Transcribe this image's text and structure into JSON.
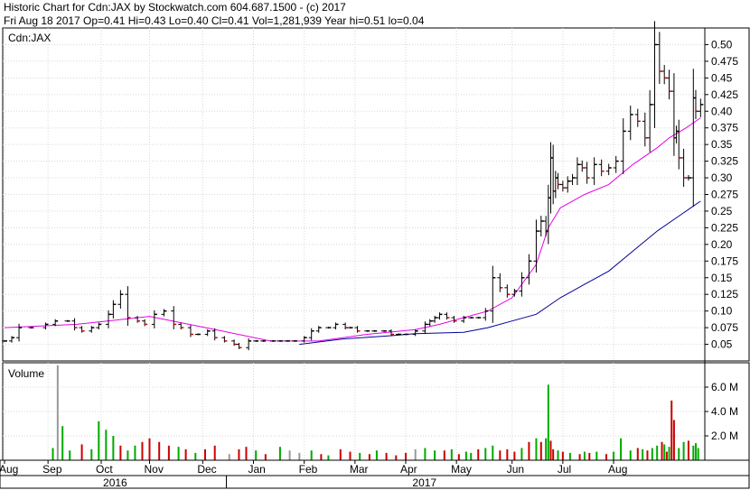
{
  "header": {
    "title": "Historic Chart for Cdn:JAX by Stockwatch.com 604.687.1500 - (c) 2017",
    "summary": "Fri Aug 18 2017  Op=0.41  Hi=0.43  Lo=0.40  Cl=0.41  Vol=1,281,939  Year hi=0.51  lo=0.04"
  },
  "chart_data": [
    {
      "type": "ohlc",
      "title": "Cdn:JAX",
      "ylim": [
        0.025,
        0.525
      ],
      "yticks": [
        "0.05",
        "0.075",
        "0.10",
        "0.125",
        "0.15",
        "0.175",
        "0.20",
        "0.225",
        "0.25",
        "0.275",
        "0.30",
        "0.325",
        "0.35",
        "0.375",
        "0.40",
        "0.425",
        "0.45",
        "0.475",
        "0.50"
      ],
      "grid": true,
      "colors": {
        "bar": "#000000",
        "up": "#000000",
        "down": "#cc0000",
        "ma_short": "#e600e6",
        "ma_long": "#000099"
      },
      "series": [
        {
          "name": "price_close",
          "x": [
            0,
            3,
            6,
            11,
            17,
            21,
            26,
            29,
            32,
            36,
            39,
            43,
            45,
            48,
            51,
            55,
            58,
            62,
            66,
            70,
            73,
            77,
            80,
            84,
            87,
            91,
            95,
            97,
            101,
            104,
            107,
            111,
            114,
            117,
            120,
            124,
            127,
            130,
            134,
            137,
            141,
            143,
            146,
            150,
            153,
            157,
            160,
            163,
            166,
            170,
            174,
            176,
            178,
            180,
            183,
            186,
            190,
            193,
            196,
            199,
            202,
            205,
            208,
            211,
            214,
            217,
            220,
            222,
            224,
            225,
            226,
            227,
            228,
            229,
            231,
            233,
            235,
            237,
            239,
            241,
            244,
            247,
            250,
            253,
            256,
            259,
            262,
            265,
            267,
            269,
            271,
            273,
            275,
            277,
            278,
            279,
            281,
            283,
            285,
            286,
            288
          ],
          "values": [
            0.055,
            0.06,
            0.075,
            0.075,
            0.08,
            0.085,
            0.085,
            0.075,
            0.07,
            0.075,
            0.08,
            0.095,
            0.11,
            0.125,
            0.09,
            0.085,
            0.08,
            0.095,
            0.1,
            0.08,
            0.075,
            0.065,
            0.065,
            0.07,
            0.06,
            0.055,
            0.05,
            0.045,
            0.055,
            0.055,
            0.055,
            0.055,
            0.055,
            0.055,
            0.055,
            0.06,
            0.07,
            0.075,
            0.075,
            0.08,
            0.075,
            0.075,
            0.07,
            0.07,
            0.07,
            0.07,
            0.065,
            0.065,
            0.065,
            0.07,
            0.08,
            0.085,
            0.09,
            0.095,
            0.09,
            0.085,
            0.09,
            0.09,
            0.09,
            0.1,
            0.15,
            0.135,
            0.125,
            0.13,
            0.15,
            0.175,
            0.22,
            0.235,
            0.22,
            0.27,
            0.33,
            0.28,
            0.3,
            0.29,
            0.285,
            0.295,
            0.3,
            0.32,
            0.315,
            0.3,
            0.32,
            0.31,
            0.315,
            0.325,
            0.37,
            0.395,
            0.385,
            0.36,
            0.41,
            0.5,
            0.46,
            0.45,
            0.43,
            0.36,
            0.37,
            0.33,
            0.3,
            0.3,
            0.42,
            0.4,
            0.41
          ]
        },
        {
          "name": "ma_short",
          "x": [
            0,
            30,
            60,
            90,
            110,
            130,
            150,
            170,
            180,
            190,
            200,
            210,
            220,
            225,
            230,
            240,
            250,
            260,
            270,
            275,
            282,
            288
          ],
          "values": [
            0.075,
            0.08,
            0.092,
            0.07,
            0.055,
            0.055,
            0.065,
            0.072,
            0.08,
            0.09,
            0.1,
            0.12,
            0.17,
            0.225,
            0.255,
            0.275,
            0.29,
            0.32,
            0.345,
            0.36,
            0.375,
            0.39
          ]
        },
        {
          "name": "ma_long",
          "x": [
            122,
            140,
            160,
            170,
            180,
            190,
            200,
            210,
            220,
            230,
            240,
            250,
            260,
            270,
            280,
            288
          ],
          "values": [
            0.05,
            0.058,
            0.063,
            0.066,
            0.067,
            0.068,
            0.075,
            0.085,
            0.095,
            0.12,
            0.14,
            0.16,
            0.19,
            0.22,
            0.245,
            0.265
          ]
        }
      ]
    },
    {
      "type": "bar",
      "title": "Volume",
      "ylim": [
        0,
        8
      ],
      "ylabel": "",
      "yticks": [
        "2.0 M",
        "4.0 M",
        "6.0 M"
      ],
      "grid": true,
      "colors": {
        "up": "#00aa00",
        "down": "#cc0000",
        "unchanged": "#999999"
      },
      "x": [
        20,
        22,
        24,
        27,
        32,
        36,
        39,
        42,
        45,
        48,
        51,
        54,
        57,
        60,
        64,
        68,
        72,
        75,
        79,
        83,
        87,
        93,
        97,
        100,
        104,
        108,
        114,
        118,
        122,
        127,
        131,
        134,
        139,
        143,
        147,
        151,
        154,
        158,
        162,
        166,
        170,
        174,
        178,
        182,
        185,
        188,
        191,
        193,
        196,
        199,
        202,
        205,
        208,
        211,
        214,
        217,
        220,
        222,
        224,
        225,
        226,
        227,
        229,
        231,
        234,
        238,
        240,
        242,
        245,
        249,
        252,
        255,
        259,
        262,
        264,
        266,
        268,
        270,
        272,
        273,
        274,
        275,
        276,
        277,
        279,
        281,
        283,
        285,
        286,
        287
      ],
      "values": [
        1.0,
        7.8,
        2.8,
        0.8,
        1.3,
        0.9,
        3.2,
        2.5,
        2.0,
        1.2,
        0.8,
        1.2,
        1.5,
        1.8,
        1.5,
        1.2,
        1.1,
        0.9,
        0.6,
        0.9,
        1.2,
        0.5,
        0.9,
        1.1,
        0.8,
        0.5,
        1.1,
        0.8,
        0.6,
        0.8,
        0.5,
        0.4,
        0.9,
        0.7,
        0.6,
        0.5,
        0.8,
        0.6,
        0.4,
        0.6,
        0.9,
        1.0,
        0.8,
        0.8,
        0.9,
        0.5,
        0.7,
        0.6,
        0.9,
        1.0,
        1.2,
        0.8,
        0.9,
        0.7,
        1.0,
        1.5,
        1.8,
        1.5,
        1.8,
        6.2,
        1.6,
        0.9,
        0.8,
        0.7,
        0.6,
        0.5,
        0.7,
        0.6,
        0.7,
        0.5,
        0.7,
        1.8,
        0.8,
        1.0,
        0.9,
        0.8,
        1.0,
        1.2,
        1.5,
        1.3,
        0.7,
        1.1,
        4.9,
        3.3,
        1.0,
        1.5,
        1.6,
        1.2,
        1.4,
        1.0
      ],
      "dirs": [
        "g",
        "u",
        "g",
        "g",
        "r",
        "g",
        "g",
        "g",
        "g",
        "r",
        "g",
        "g",
        "r",
        "r",
        "r",
        "r",
        "g",
        "r",
        "g",
        "r",
        "r",
        "u",
        "r",
        "r",
        "g",
        "r",
        "g",
        "u",
        "u",
        "g",
        "r",
        "g",
        "r",
        "r",
        "g",
        "r",
        "g",
        "r",
        "r",
        "r",
        "u",
        "g",
        "g",
        "r",
        "g",
        "r",
        "g",
        "g",
        "r",
        "g",
        "g",
        "r",
        "r",
        "r",
        "g",
        "r",
        "g",
        "r",
        "g",
        "g",
        "r",
        "r",
        "g",
        "r",
        "g",
        "r",
        "g",
        "r",
        "g",
        "r",
        "g",
        "g",
        "g",
        "r",
        "g",
        "r",
        "g",
        "g",
        "r",
        "g",
        "r",
        "g",
        "r",
        "r",
        "g",
        "g",
        "r",
        "g",
        "g",
        "g"
      ]
    }
  ],
  "time_axis": {
    "months": [
      {
        "label": "Aug",
        "x": 0
      },
      {
        "label": "Sep",
        "x": 18
      },
      {
        "label": "Oct",
        "x": 40
      },
      {
        "label": "Nov",
        "x": 60
      },
      {
        "label": "Dec",
        "x": 82
      },
      {
        "label": "Jan",
        "x": 103
      },
      {
        "label": "Feb",
        "x": 124
      },
      {
        "label": "Mar",
        "x": 145
      },
      {
        "label": "Apr",
        "x": 166
      },
      {
        "label": "May",
        "x": 187
      },
      {
        "label": "Jun",
        "x": 210
      },
      {
        "label": "Jul",
        "x": 231
      },
      {
        "label": "Aug",
        "x": 252
      }
    ],
    "years": [
      {
        "label": "2016",
        "x": 46
      },
      {
        "label": "2017",
        "x": 174
      }
    ],
    "range": [
      0,
      289
    ]
  }
}
